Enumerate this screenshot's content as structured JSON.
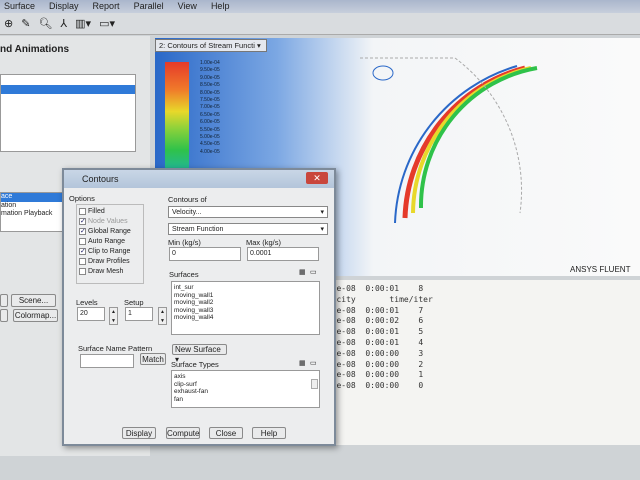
{
  "menu": [
    "Surface",
    "Display",
    "Report",
    "Parallel",
    "View",
    "Help"
  ],
  "left_panel": {
    "title": "nd Animations",
    "list_items": [
      "ace",
      "ation",
      "mation Playback"
    ],
    "scene_button": "Scene...",
    "colormap_button": "Colormap..."
  },
  "graphics": {
    "window_select": "2: Contours of Stream Functi",
    "legend": [
      "1.00e-04",
      "9.50e-05",
      "9.00e-05",
      "8.50e-05",
      "8.00e-05",
      "7.50e-05",
      "7.00e-05",
      "6.50e-05",
      "6.00e-05",
      "5.50e-05",
      "5.00e-05",
      "4.50e-05",
      "4.00e-05"
    ],
    "brand": "ANSYS FLUENT"
  },
  "console": {
    "lines": [
      "006e-08  0:00:01    8",
      "elocity       time/iter",
      "268e-08  0:00:01    7",
      "326e-08  0:00:02    6",
      "325e-08  0:00:01    5",
      "459e-08  0:00:01    4",
      "474e-08  0:00:00    3",
      "552e-08  0:00:00    2",
      "063e-08  0:00:00    1",
      "421e-08  0:00:00    0"
    ]
  },
  "dialog": {
    "title": "Contours",
    "options_label": "Options",
    "options": [
      {
        "label": "Filled",
        "checked": false
      },
      {
        "label": "Node Values",
        "checked": true,
        "disabled": true
      },
      {
        "label": "Global Range",
        "checked": true
      },
      {
        "label": "Auto Range",
        "checked": false
      },
      {
        "label": "Clip to Range",
        "checked": true
      },
      {
        "label": "Draw Profiles",
        "checked": false
      },
      {
        "label": "Draw Mesh",
        "checked": false
      }
    ],
    "contours_of_label": "Contours of",
    "contours_of": "Velocity...",
    "sub_quantity": "Stream Function",
    "min_label": "Min (kg/s)",
    "min_value": "0",
    "max_label": "Max (kg/s)",
    "max_value": "0.0001",
    "surfaces_label": "Surfaces",
    "surfaces": [
      "int_sur",
      "moving_wall1",
      "moving_wall2",
      "moving_wall3",
      "moving_wall4"
    ],
    "levels_label": "Levels",
    "levels": "20",
    "setup_label": "Setup",
    "setup": "1",
    "pattern_label": "Surface Name Pattern",
    "pattern_value": "",
    "match_button": "Match",
    "new_surface": "New Surface",
    "surface_types_label": "Surface Types",
    "surface_types": [
      "axis",
      "clip-surf",
      "exhaust-fan",
      "fan"
    ],
    "buttons": {
      "display": "Display",
      "compute": "Compute",
      "close": "Close",
      "help": "Help"
    }
  }
}
